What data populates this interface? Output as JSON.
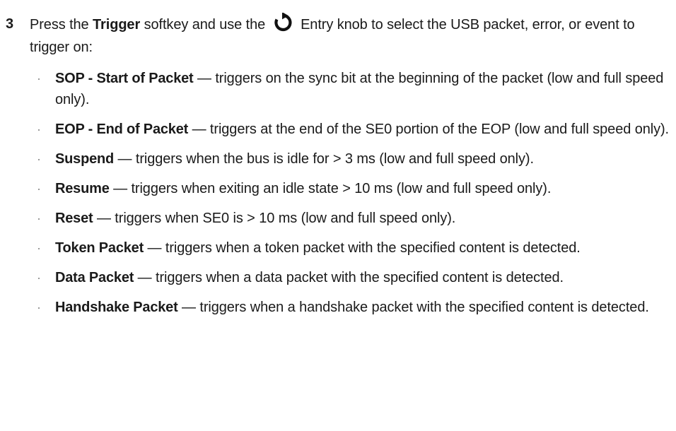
{
  "step": {
    "number": "3",
    "intro_prefix": "Press the ",
    "softkey_label": "Trigger",
    "intro_middle": " softkey and use the ",
    "knob_icon": "entry-knob-icon",
    "intro_suffix": " Entry knob to select the USB packet, error, or event to trigger on:"
  },
  "items": [
    {
      "term": "SOP - Start of Packet",
      "description": " — triggers on the sync bit at the beginning of the packet (low and full speed only)."
    },
    {
      "term": "EOP - End of Packet",
      "description": " — triggers at the end of the SE0 portion of the EOP (low and full speed only)."
    },
    {
      "term": "Suspend",
      "description": " — triggers when the bus is idle for > 3 ms (low and full speed only)."
    },
    {
      "term": "Resume",
      "description": " — triggers when exiting an idle state > 10 ms (low and full speed only)."
    },
    {
      "term": "Reset",
      "description": " — triggers when SE0 is > 10 ms (low and full speed only)."
    },
    {
      "term": "Token Packet",
      "description": " — triggers when a token packet with the specified content is detected."
    },
    {
      "term": "Data Packet",
      "description": " — triggers when a data packet with the specified content is detected."
    },
    {
      "term": "Handshake Packet",
      "description": " — triggers when a handshake packet with the specified content is detected."
    }
  ],
  "bullet_glyph": "·"
}
